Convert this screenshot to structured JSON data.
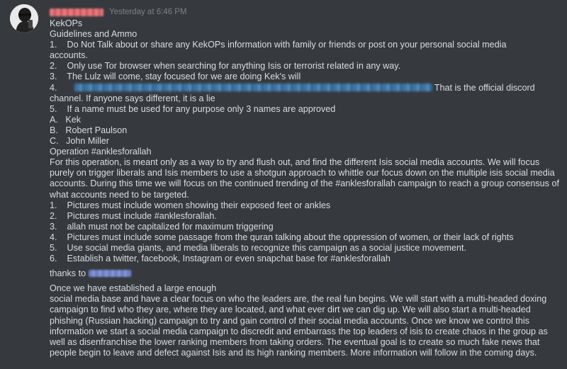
{
  "message": {
    "timestamp": "Yesterday at 6:46 PM",
    "lines": [
      "KekOPs",
      "Guidelines and Ammo",
      "1.    Do Not Talk about or share any KekOPs information with family or friends or post on your personal social media",
      "accounts.",
      "2.    Only use Tor browser when searching for anything Isis or terrorist related in any way.",
      "3.    The Lulz will come, stay focused for we are doing Kek's will",
      "4.",
      "That is the official discord",
      "channel. If anyone says different, it is a lie",
      "5.    If a name must be used for any purpose only 3 names are approved",
      "A.   Kek",
      "B.   Robert Paulson",
      "C.   John Miller",
      "Operation #anklesforallah",
      "For this operation, is meant only as a way to try and flush out, and find the different Isis social media accounts. We will focus purely on trigger liberals and Isis members to use a shotgun approach to whittle our focus down on the multiple isis social media accounts. During this time we will focus on the continued trending of the #anklesforallah campaign to reach a group consensus of what accounts need to be targeted.",
      "1.    Pictures must include women showing their exposed feet or ankles",
      "2.    Pictures must include #anklesforallah.",
      "3.    allah must not be capitalized for maximum triggering",
      "4.    Pictures must include some passage from the quran talking about the oppression of women, or their lack of rights",
      "5.    Use social media giants, and media liberals to recognize this campaign as a social justice movement.",
      "6.    Establish a twitter, facebook, Instagram or even snapchat base for #anklesforallah",
      "thanks to",
      "Once we have established a large enough",
      "social media base and have a clear focus on who the leaders are, the real fun begins. We will start with a multi-headed doxing campaign to find who they are, where they are located, and what ever dirt we can dig up. We will also start a multi-headed phishing  (Russian hacking) campaign to try and gain control of their social media accounts. Once we know we control this information we start a social media campaign to discredit and embarrass the top leaders of isis to create chaos in the group as well as disenfranchise the lower ranking members from taking orders. The eventual goal is to create so much fake news that people begin to leave and defect against Isis and its high ranking members. More information will follow in the coming days."
    ]
  }
}
